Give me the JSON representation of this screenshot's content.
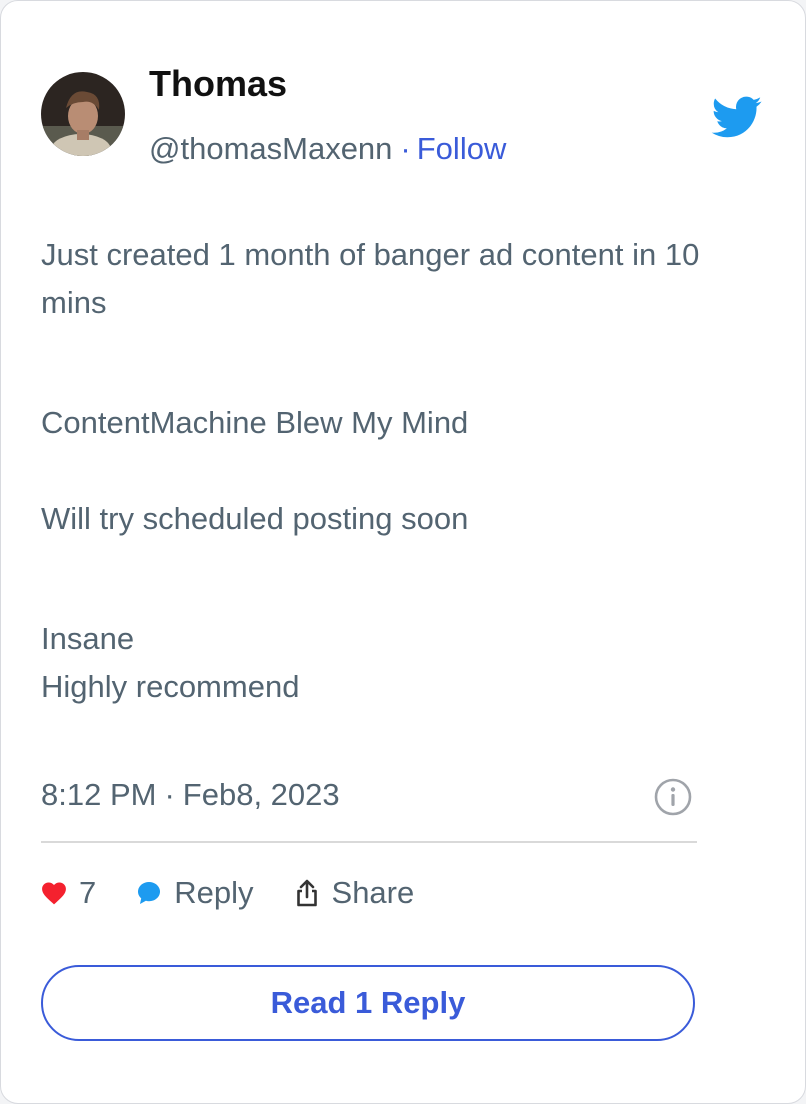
{
  "tweet": {
    "author": {
      "name": "Thomas",
      "handle": "@thomasMaxenn",
      "separator": "·",
      "follow_label": "Follow",
      "avatar_icon": "user-avatar-photo"
    },
    "brand_icon": "twitter-bird-icon",
    "body": {
      "line1": "Just created 1 month of banger ad content in 10 mins",
      "line2": "ContentMachine Blew My Mind",
      "line3": "Will try scheduled posting soon",
      "line4": "Insane",
      "line5": "Highly recommend"
    },
    "meta": {
      "time": "8:12 PM",
      "separator": "·",
      "date": "Feb8, 2023",
      "info_icon": "info-icon"
    },
    "actions": {
      "like_count": "7",
      "reply_label": "Reply",
      "share_label": "Share"
    },
    "read_replies_label": "Read 1 Reply"
  },
  "colors": {
    "accent": "#3a5bd9",
    "twitter_blue": "#1d9bf0",
    "heart_red": "#f4212e",
    "text_secondary": "#536471",
    "text_primary": "#111111"
  }
}
